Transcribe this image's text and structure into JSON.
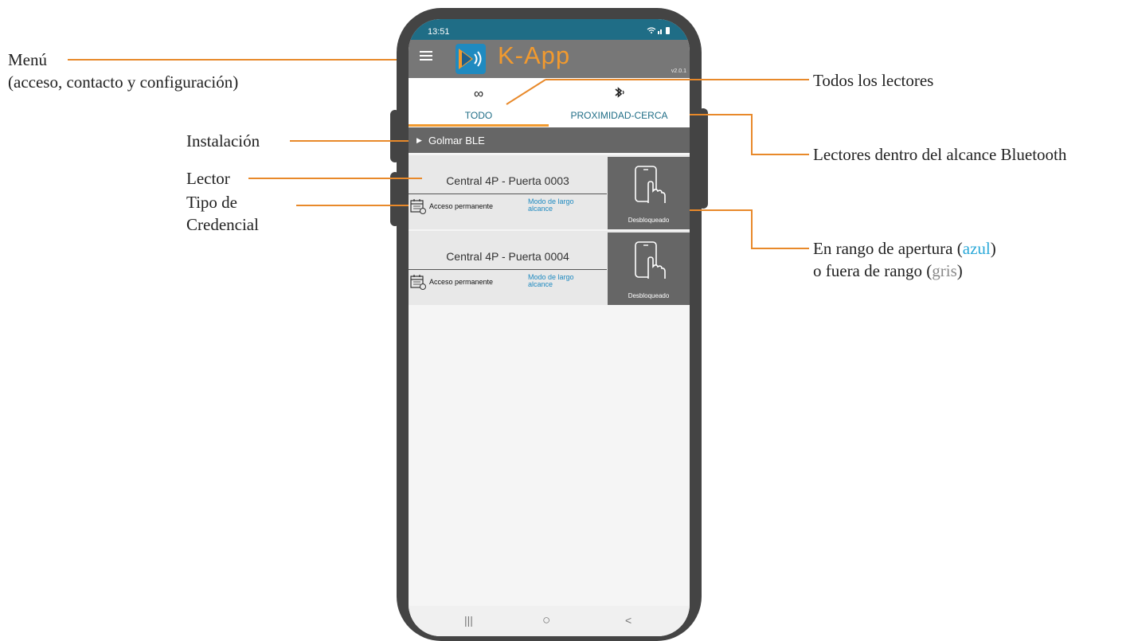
{
  "annotations": {
    "menu_title": "Menú",
    "menu_subtitle": "(acceso, contacto y configuración)",
    "all_readers": "Todos los lectores",
    "installation": "Instalación",
    "bluetooth_range": "Lectores dentro del alcance Bluetooth",
    "reader": "Lector",
    "credential_type_line1": "Tipo de",
    "credential_type_line2": "Credencial",
    "range_line1_prefix": "En rango de apertura (",
    "range_blue_word": "azul",
    "range_line1_suffix": ")",
    "range_line2_prefix": "o fuera de rango (",
    "range_gray_word": "gris",
    "range_line2_suffix": ")"
  },
  "status_bar": {
    "time": "13:51",
    "right_icons": "wifi-signal-battery"
  },
  "app_bar": {
    "logo_text": "K-App",
    "version": "v2.0.1"
  },
  "tabs": [
    {
      "icon": "infinity-icon",
      "glyph": "∞",
      "label": "TODO",
      "active": true
    },
    {
      "icon": "bluetooth-icon",
      "glyph": "✱",
      "label": "PROXIMIDAD-CERCA",
      "active": false
    }
  ],
  "group": {
    "label": "Golmar BLE"
  },
  "readers": [
    {
      "title": "Central 4P - Puerta 0003",
      "credential": "Acceso permanente",
      "mode_line1": "Modo de largo",
      "mode_line2": "alcance",
      "status": "Desbloqueado"
    },
    {
      "title": "Central 4P - Puerta 0004",
      "credential": "Acceso permanente",
      "mode_line1": "Modo de largo",
      "mode_line2": "alcance",
      "status": "Desbloqueado"
    }
  ],
  "nav_bar": {
    "recents": "|||",
    "home": "○",
    "back": "<"
  },
  "colors": {
    "accent_orange": "#f29a2e",
    "teal": "#1f6d86",
    "blue": "#1f8ac0",
    "gray_bar": "#666666"
  }
}
